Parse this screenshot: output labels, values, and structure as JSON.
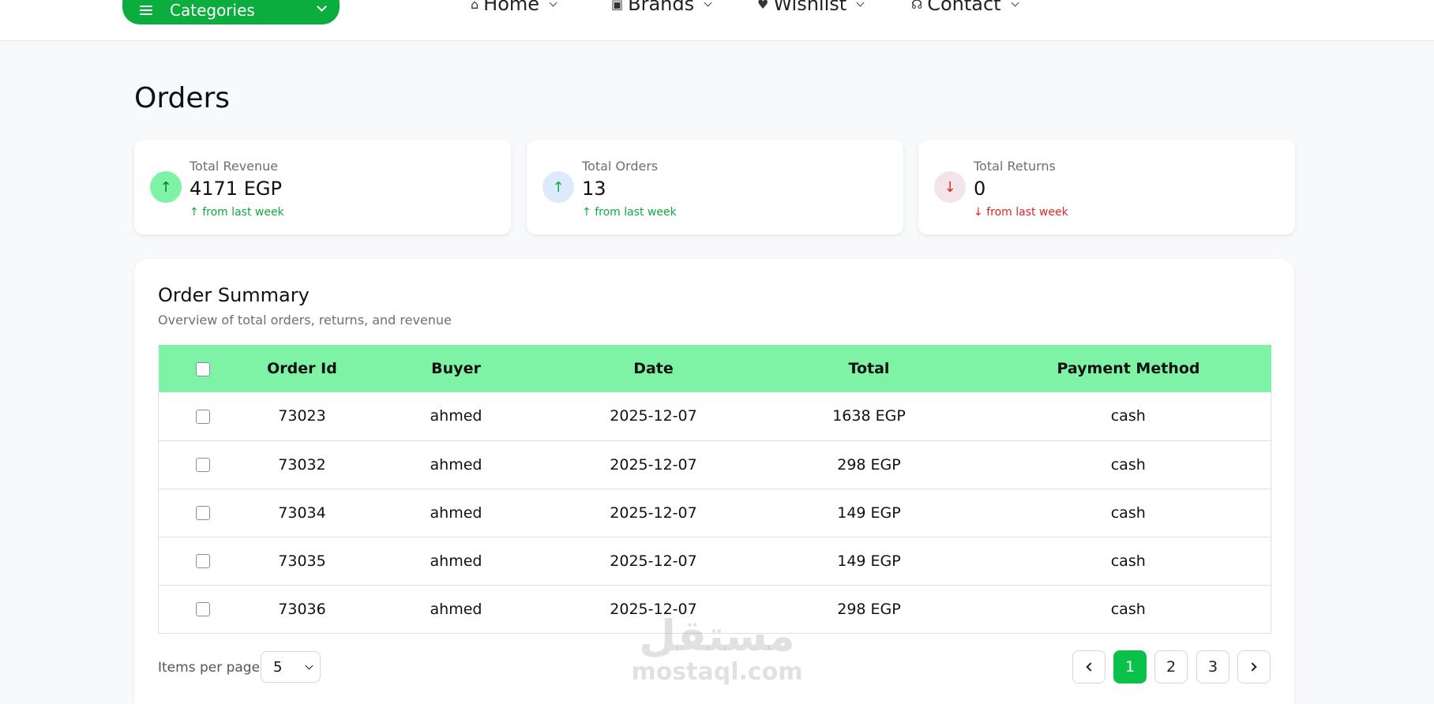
{
  "nav": {
    "categories_label": "Categories",
    "items": [
      {
        "label": "Home",
        "icon": "home-icon"
      },
      {
        "label": "Brands",
        "icon": "brand-icon"
      },
      {
        "label": "Wishlist",
        "icon": "hand-heart-icon"
      },
      {
        "label": "Contact",
        "icon": "headset-icon"
      }
    ]
  },
  "page": {
    "title": "Orders"
  },
  "stats": [
    {
      "label": "Total Revenue",
      "value": "4171 EGP",
      "trend": "from last week",
      "direction": "up"
    },
    {
      "label": "Total Orders",
      "value": "13",
      "trend": "from last week",
      "direction": "up"
    },
    {
      "label": "Total Returns",
      "value": "0",
      "trend": "from last week",
      "direction": "down"
    }
  ],
  "summary": {
    "title": "Order Summary",
    "subtitle": "Overview of total orders, returns, and revenue",
    "columns": [
      "Order Id",
      "Buyer",
      "Date",
      "Total",
      "Payment Method"
    ],
    "rows": [
      {
        "id": "73023",
        "buyer": "ahmed",
        "date": "2025-12-07",
        "total": "1638 EGP",
        "payment": "cash"
      },
      {
        "id": "73032",
        "buyer": "ahmed",
        "date": "2025-12-07",
        "total": "298 EGP",
        "payment": "cash"
      },
      {
        "id": "73034",
        "buyer": "ahmed",
        "date": "2025-12-07",
        "total": "149 EGP",
        "payment": "cash"
      },
      {
        "id": "73035",
        "buyer": "ahmed",
        "date": "2025-12-07",
        "total": "149 EGP",
        "payment": "cash"
      },
      {
        "id": "73036",
        "buyer": "ahmed",
        "date": "2025-12-07",
        "total": "298 EGP",
        "payment": "cash"
      }
    ]
  },
  "pagination": {
    "items_per_page_label": "Items per page:",
    "items_per_page_value": "5",
    "pages": [
      "1",
      "2",
      "3"
    ],
    "current": "1"
  },
  "watermark": {
    "arabic": "مستقل",
    "latin": "mostaql.com"
  },
  "colors": {
    "accent": "#0aad3e",
    "header_row": "#7ef2a5",
    "up": "#0aad3e",
    "down": "#e02424"
  }
}
